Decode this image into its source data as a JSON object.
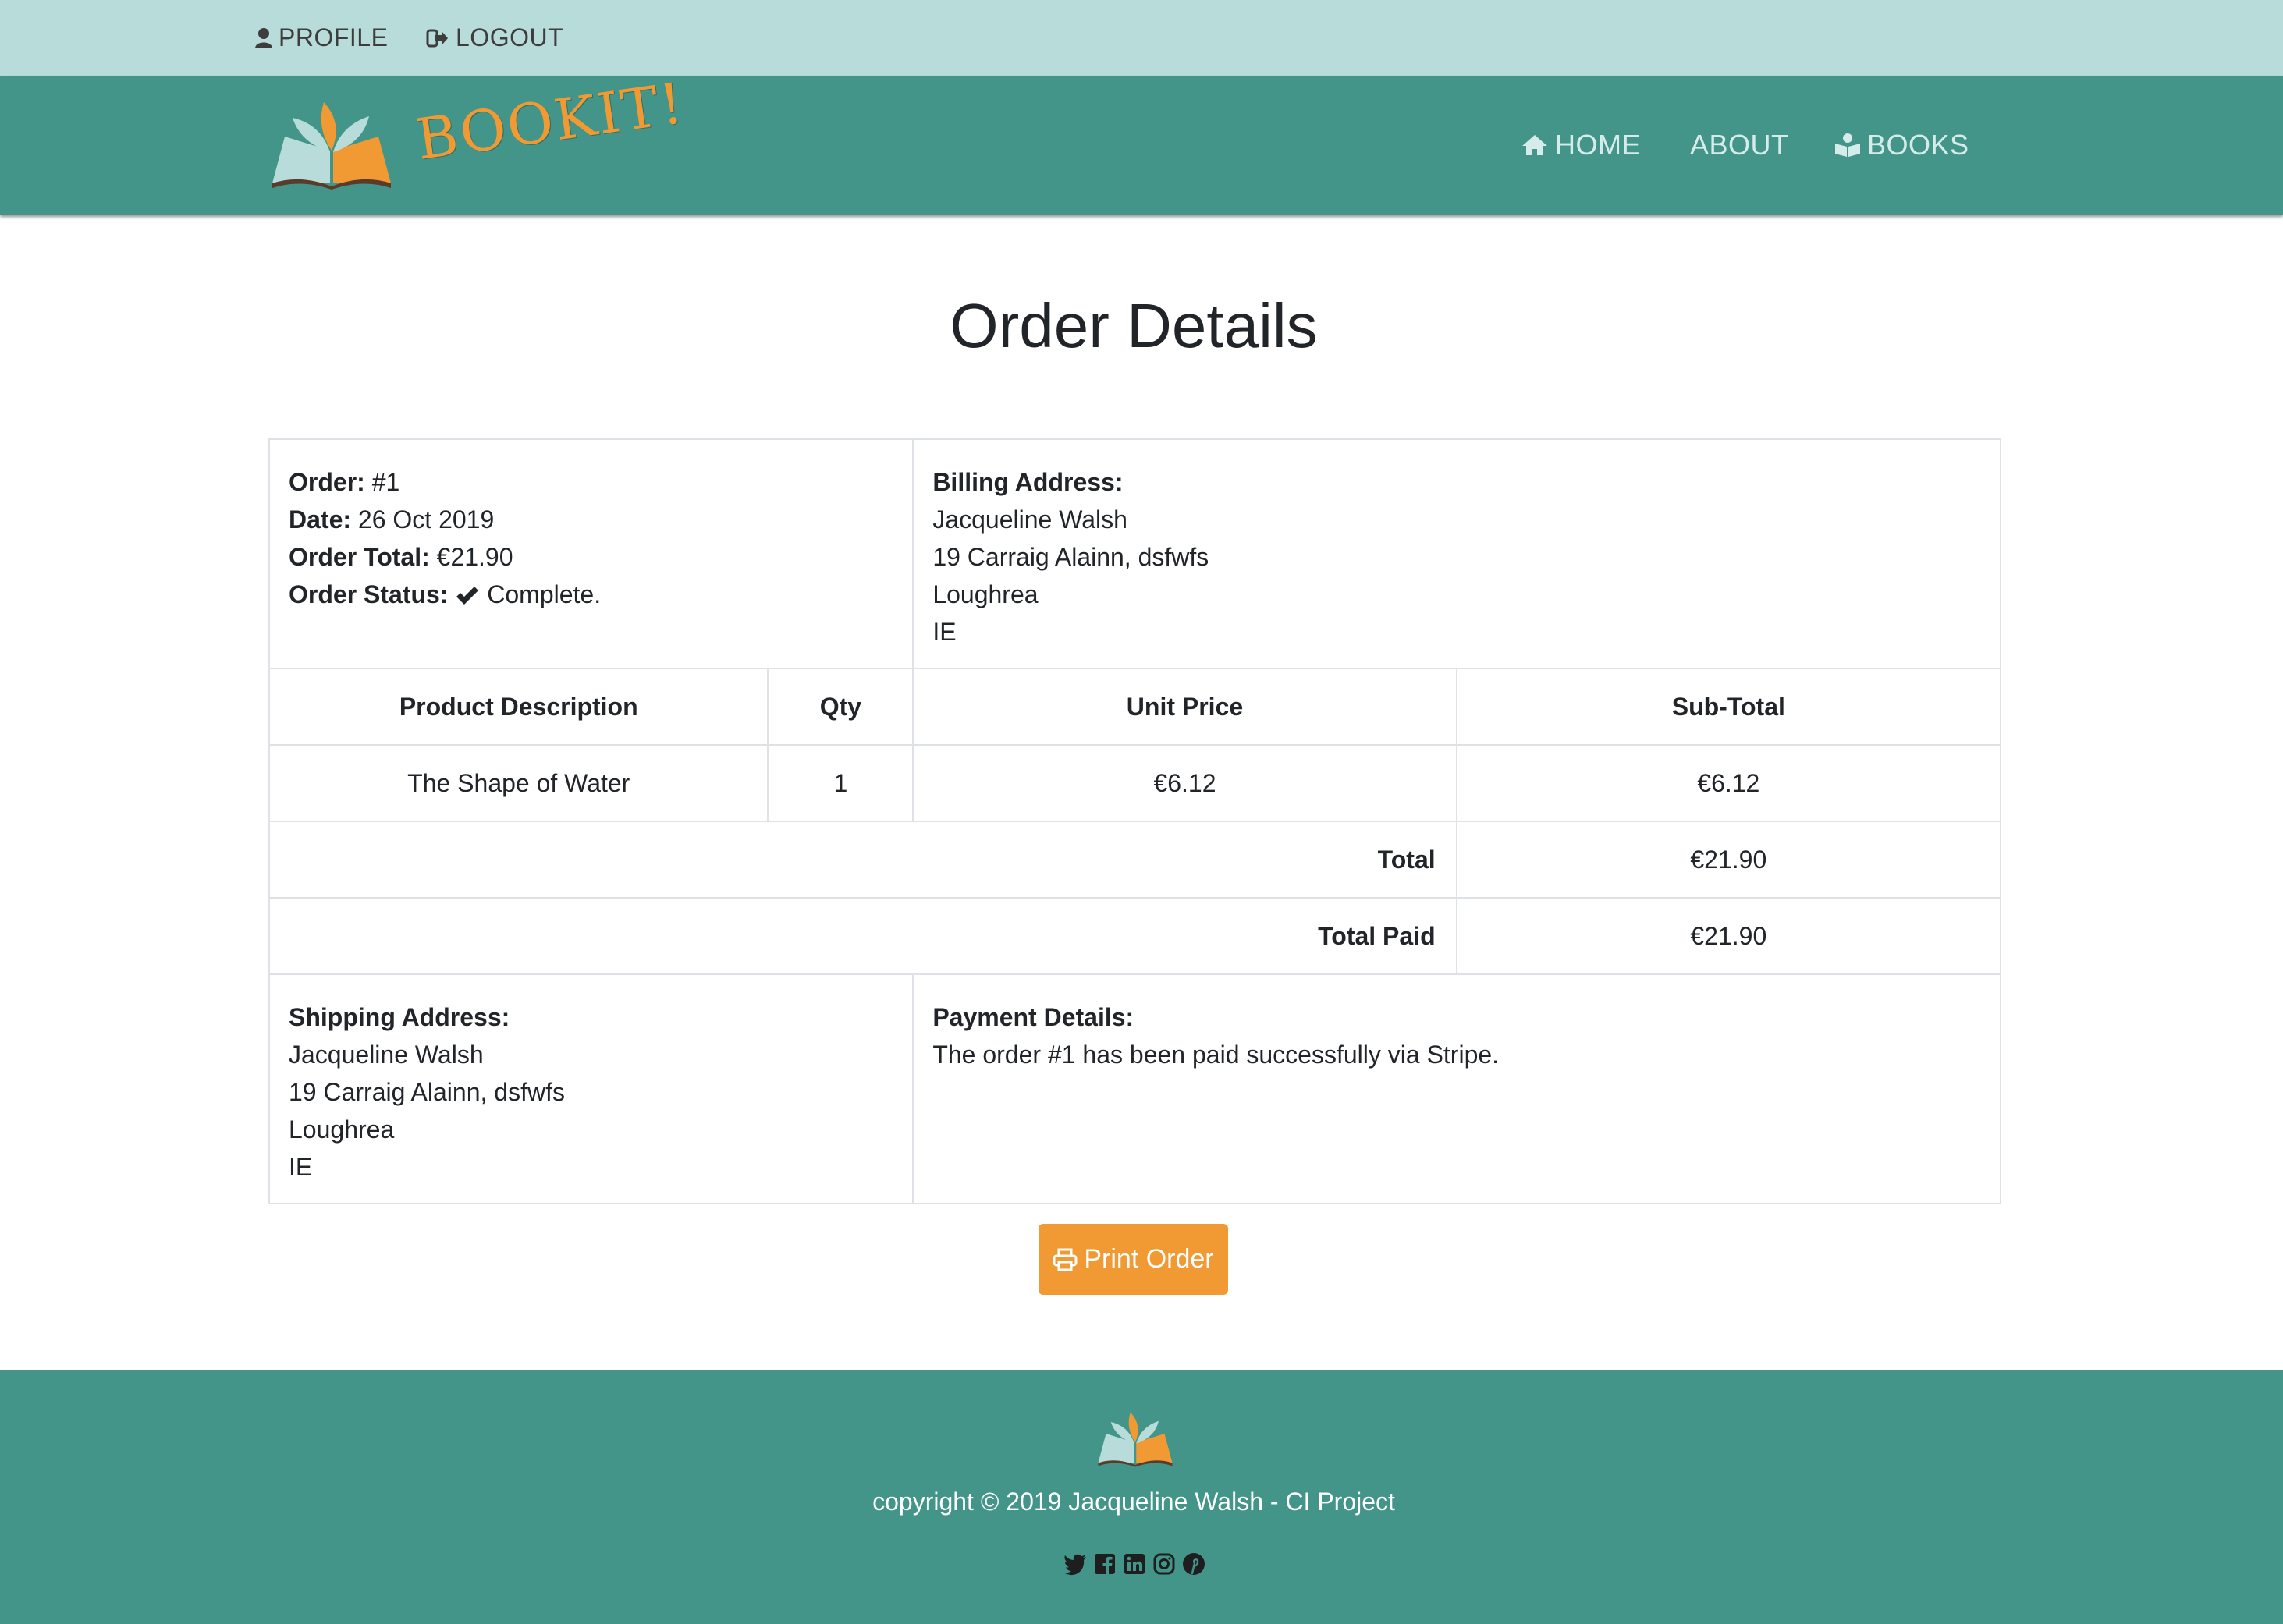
{
  "topbar": {
    "profile_label": "PROFILE",
    "logout_label": "LOGOUT"
  },
  "header": {
    "brand": "BOOKIT!",
    "nav": {
      "home": "HOME",
      "about": "ABOUT",
      "books": "BOOKS"
    }
  },
  "page": {
    "title": "Order Details"
  },
  "order": {
    "order_label": "Order:",
    "order_value": "#1",
    "date_label": "Date:",
    "date_value": "26 Oct 2019",
    "total_label": "Order Total:",
    "total_value": "€21.90",
    "status_label": "Order Status:",
    "status_value": "Complete."
  },
  "billing": {
    "label": "Billing Address:",
    "name": "Jacqueline Walsh",
    "street": "19 Carraig Alainn, dsfwfs",
    "town": "Loughrea",
    "country": "IE"
  },
  "items_table": {
    "headers": [
      "Product Description",
      "Qty",
      "Unit Price",
      "Sub-Total"
    ],
    "rows": [
      [
        "The Shape of Water",
        "1",
        "€6.12",
        "€6.12"
      ]
    ],
    "total_label": "Total",
    "total_value": "€21.90",
    "paid_label": "Total Paid",
    "paid_value": "€21.90"
  },
  "shipping": {
    "label": "Shipping Address:",
    "name": "Jacqueline Walsh",
    "street": "19 Carraig Alainn, dsfwfs",
    "town": "Loughrea",
    "country": "IE"
  },
  "payment": {
    "label": "Payment Details:",
    "text": "The order #1 has been paid successfully via Stripe."
  },
  "actions": {
    "print_label": "Print Order"
  },
  "footer": {
    "copyright": "copyright © 2019 Jacqueline Walsh - CI Project",
    "social_icons": [
      "twitter-icon",
      "facebook-icon",
      "linkedin-icon",
      "instagram-icon",
      "pinterest-icon"
    ]
  },
  "colors": {
    "topbar_bg": "#b8dcda",
    "header_bg": "#429588",
    "accent": "#f19a34"
  }
}
